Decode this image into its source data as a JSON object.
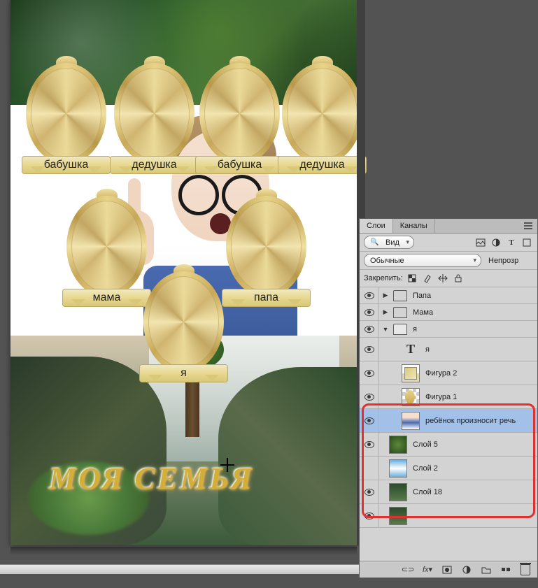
{
  "canvas": {
    "title_main": "МОЯ СЕМЬЯ",
    "frames": {
      "top1": "бабушка",
      "top2": "дедушка",
      "top3": "бабушка",
      "top4": "дедушка",
      "mid1": "мама",
      "mid2": "папа",
      "bottom": "я"
    }
  },
  "panel": {
    "tabs": {
      "layers": "Слои",
      "channels": "Каналы"
    },
    "filter_kind": "Вид",
    "blend_mode": "Обычные",
    "opacity_label": "Непрозр",
    "lock_label": "Закрепить:",
    "layers": {
      "papa": "Папа",
      "mama": "Мама",
      "group_ya": "я",
      "text_ya": "я",
      "figura2": "Фигура 2",
      "figura1": "Фигура 1",
      "child_speech": "ребёнок произносит речь",
      "sloi5": "Слой 5",
      "sloi2": "Слой 2",
      "sloi18": "Слой 18"
    },
    "bottom": {
      "link": "⊂⊃",
      "fx": "fx"
    }
  }
}
